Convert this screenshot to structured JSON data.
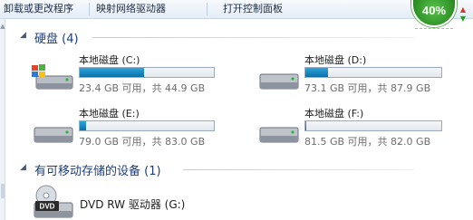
{
  "toolbar": {
    "items": [
      "卸载或更改程序",
      "映射网络驱动器",
      "打开控制面板"
    ]
  },
  "badge": {
    "percent": "40%",
    "up_icon": "arrow-up-icon",
    "down_icon": "arrow-down-icon",
    "color": "#2f9227"
  },
  "sections": {
    "hdd": {
      "title": "硬盘 (4)"
    },
    "removable": {
      "title": "有可移动存储的设备 (1)"
    }
  },
  "drives": [
    {
      "name": "本地磁盘 (C:)",
      "size": "23.4 GB 可用，共 44.9 GB",
      "used_fraction": 0.479,
      "icon": "windows-drive-icon"
    },
    {
      "name": "本地磁盘 (D:)",
      "size": "73.1 GB 可用，共 87.9 GB",
      "used_fraction": 0.168,
      "icon": "hard-drive-icon"
    },
    {
      "name": "本地磁盘 (E:)",
      "size": "79.0 GB 可用，共 83.0 GB",
      "used_fraction": 0.048,
      "icon": "hard-drive-icon"
    },
    {
      "name": "本地磁盘 (F:)",
      "size": "81.5 GB 可用，共 82.0 GB",
      "used_fraction": 0.006,
      "icon": "hard-drive-icon"
    }
  ],
  "dvd": {
    "name": "DVD RW 驱动器 (G:)",
    "icon_text": "DVD",
    "icon": "dvd-drive-icon"
  },
  "colors": {
    "bar_fill": "#1786bf",
    "section_title": "#1f3d7a"
  }
}
